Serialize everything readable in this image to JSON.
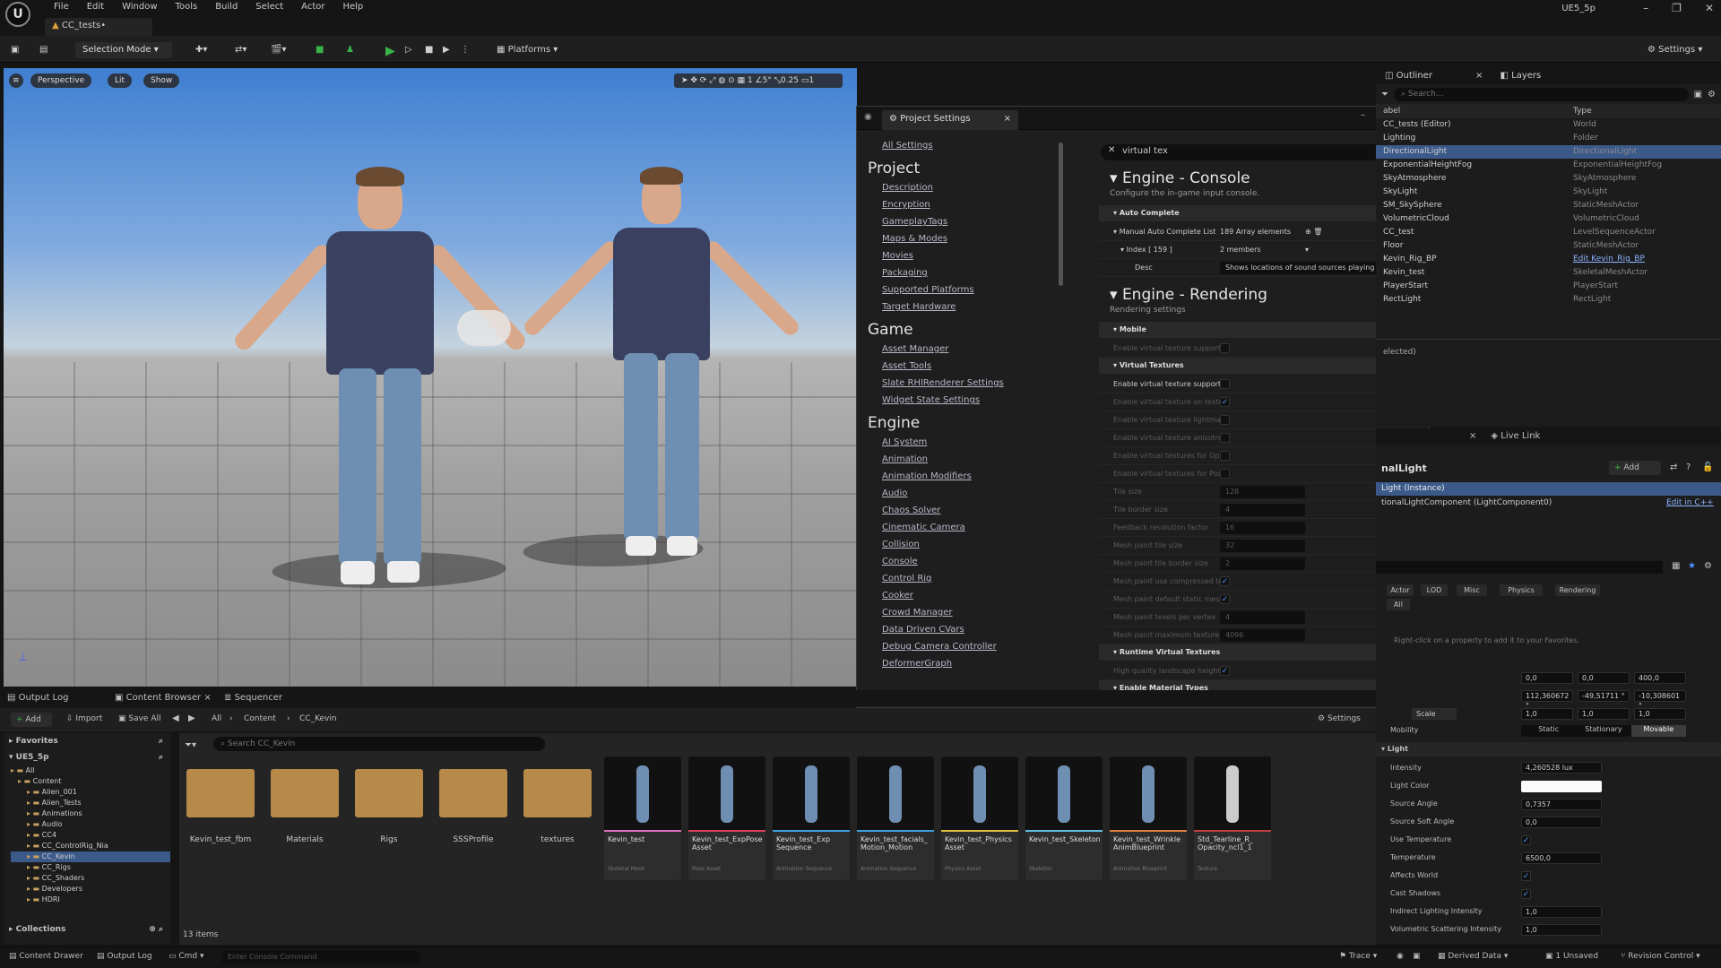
{
  "menu": [
    "File",
    "Edit",
    "Window",
    "Tools",
    "Build",
    "Select",
    "Actor",
    "Help"
  ],
  "doc_tab": "CC_tests•",
  "project_name": "UE5_5p",
  "toolbar": {
    "selection_mode": "Selection Mode",
    "platforms": "Platforms",
    "settings": "Settings"
  },
  "viewport": {
    "perspective": "Perspective",
    "lit": "Lit",
    "show": "Show",
    "snap_deg": "5°",
    "grid": "1",
    "scale": "0.25",
    "cam": "1"
  },
  "project_settings": {
    "title": "Project Settings",
    "all_settings": "All Settings",
    "search": "virtual tex",
    "nav": [
      {
        "head": "Project",
        "links": [
          "Description",
          "Encryption",
          "GameplayTags",
          "Maps & Modes",
          "Movies",
          "Packaging",
          "Supported Platforms",
          "Target Hardware"
        ]
      },
      {
        "head": "Game",
        "links": [
          "Asset Manager",
          "Asset Tools",
          "Slate RHIRenderer Settings",
          "Widget State Settings"
        ]
      },
      {
        "head": "Engine",
        "links": [
          "AI System",
          "Animation",
          "Animation Modifiers",
          "Audio",
          "Chaos Solver",
          "Cinematic Camera",
          "Collision",
          "Console",
          "Control Rig",
          "Cooker",
          "Crowd Manager",
          "Data Driven CVars",
          "Debug Camera Controller",
          "DeformerGraph"
        ]
      }
    ],
    "console": {
      "title": "Engine - Console",
      "desc": "Configure the in-game input console.",
      "category": "Auto Complete",
      "list_label": "Manual Auto Complete List",
      "list_value": "189 Array elements",
      "index_label": "Index [ 159 ]",
      "index_value": "2 members",
      "desc_label": "Desc",
      "desc_value": "Shows locations of sound sources playing (s"
    },
    "rendering": {
      "title": "Engine - Rendering",
      "desc": "Rendering settings",
      "mobile": "Mobile",
      "mobile_prop": "Enable virtual texture support",
      "vt": "Virtual Textures",
      "props": [
        {
          "n": "Enable virtual texture support",
          "v": "",
          "dim": false
        },
        {
          "n": "Enable virtual texture on textur...",
          "v": "✓",
          "dim": true
        },
        {
          "n": "Enable virtual texture lightmaps",
          "v": "",
          "dim": true
        },
        {
          "n": "Enable virtual texture anisotro...",
          "v": "",
          "dim": true
        },
        {
          "n": "Enable virtual textures for Opa...",
          "v": "",
          "dim": true
        },
        {
          "n": "Enable virtual textures for Pos...",
          "v": "",
          "dim": true
        },
        {
          "n": "Tile size",
          "v": "128",
          "dim": true
        },
        {
          "n": "Tile border size",
          "v": "4",
          "dim": true
        },
        {
          "n": "Feedback resolution factor",
          "v": "16",
          "dim": true
        },
        {
          "n": "Mesh paint tile size",
          "v": "32",
          "dim": true
        },
        {
          "n": "Mesh paint tile border size",
          "v": "2",
          "dim": true
        },
        {
          "n": "Mesh paint use compressed te...",
          "v": "✓",
          "dim": true
        },
        {
          "n": "Mesh paint default static mes...",
          "v": "✓",
          "dim": true
        },
        {
          "n": "Mesh paint texels per vertex",
          "v": "4",
          "dim": true
        },
        {
          "n": "Mesh paint maximum texture...",
          "v": "4096",
          "dim": true
        }
      ],
      "rvt": "Runtime Virtual Textures",
      "rvt_prop": "High quality landscape height...",
      "emt": "Enable Material Types"
    }
  },
  "outliner": {
    "tab": "Outliner",
    "layers_tab": "Layers",
    "search": "Search...",
    "col_label": "abel",
    "col_type": "Type",
    "rows": [
      {
        "n": "CC_tests (Editor)",
        "t": "World"
      },
      {
        "n": "Lighting",
        "t": "Folder"
      },
      {
        "n": "DirectionalLight",
        "t": "DirectionalLight",
        "sel": true
      },
      {
        "n": "ExponentialHeightFog",
        "t": "ExponentialHeightFog"
      },
      {
        "n": "SkyAtmosphere",
        "t": "SkyAtmosphere"
      },
      {
        "n": "SkyLight",
        "t": "SkyLight"
      },
      {
        "n": "SM_SkySphere",
        "t": "StaticMeshActor"
      },
      {
        "n": "VolumetricCloud",
        "t": "VolumetricCloud"
      },
      {
        "n": "CC_test",
        "t": "LevelSequenceActor"
      },
      {
        "n": "Floor",
        "t": "StaticMeshActor"
      },
      {
        "n": "Kevin_Rig_BP",
        "t": "Edit Kevin_Rig_BP"
      },
      {
        "n": "Kevin_test",
        "t": "SkeletalMeshActor"
      },
      {
        "n": "PlayerStart",
        "t": "PlayerStart"
      },
      {
        "n": "RectLight",
        "t": "RectLight"
      }
    ],
    "selected_status": "elected)"
  },
  "details": {
    "live_link": "Live Link",
    "title": "nalLight",
    "add": "Add",
    "instance": "Light (Instance)",
    "component": "tionalLightComponent (LightComponent0)",
    "edit_cpp": "Edit in C++",
    "filters": [
      "Actor",
      "LOD",
      "Misc",
      "Physics",
      "Rendering",
      "All"
    ],
    "favorites_hint": "Right-click on a property to add it to your Favorites.",
    "loc": [
      "0,0",
      "0,0",
      "400,0"
    ],
    "rot": [
      "112,360672 °",
      "-49,51711 °",
      "-10,308601 °"
    ],
    "scale_label": "Scale",
    "scale": [
      "1,0",
      "1,0",
      "1,0"
    ],
    "mobility": "Mobility",
    "mobility_opts": [
      "Static",
      "Stationary",
      "Movable"
    ],
    "light_cat": "Light",
    "intensity_label": "Intensity",
    "intensity": "4,260528 lux",
    "color_label": "Light Color",
    "source_angle_label": "Source Angle",
    "source_angle": "0,7357",
    "source_soft_label": "Source Soft Angle",
    "source_soft": "0,0",
    "use_temp_label": "Use Temperature",
    "temp_label": "Temperature",
    "temp": "6500,0",
    "affects_world_label": "Affects World",
    "cast_shadows_label": "Cast Shadows",
    "indirect_label": "Indirect Lighting Intensity",
    "indirect": "1,0",
    "volumetric_label": "Volumetric Scattering Intensity",
    "volumetric": "1,0"
  },
  "bottom": {
    "tabs": [
      "Output Log",
      "Content Browser",
      "Sequencer"
    ],
    "add": "Add",
    "import": "Import",
    "save_all": "Save All",
    "breadcrumb": [
      "All",
      "Content",
      "CC_Kevin"
    ],
    "settings": "Settings",
    "favorites": "Favorites",
    "project": "UE5_5p",
    "search": "Search CC_Kevin",
    "tree": [
      "All",
      "Content",
      "Alien_001",
      "Alien_Tests",
      "Animations",
      "Audio",
      "CC4",
      "CC_ControlRig_Nia",
      "CC_Kevin",
      "CC_Rigs",
      "CC_Shaders",
      "Developers",
      "HDRI"
    ],
    "collections": "Collections",
    "count": "13 items",
    "folders": [
      "Kevin_test_fbm",
      "Materials",
      "Rigs",
      "SSSProfile",
      "textures"
    ],
    "assets": [
      {
        "n": "Kevin_test",
        "t": "Skeletal Mesh",
        "c": "#e070c0"
      },
      {
        "n": "Kevin_test_ExpPose Asset",
        "t": "Pose Asset",
        "c": "#e04060"
      },
      {
        "n": "Kevin_test_Exp Sequence",
        "t": "Animation Sequence",
        "c": "#40a0e0"
      },
      {
        "n": "Kevin_test_facials_ Motion_Motion",
        "t": "Animation Sequence",
        "c": "#40a0e0"
      },
      {
        "n": "Kevin_test_Physics Asset",
        "t": "Physics Asset",
        "c": "#e0c040"
      },
      {
        "n": "Kevin_test_Skeleton",
        "t": "Skeleton",
        "c": "#60c0e0"
      },
      {
        "n": "Kevin_test_Wrinkle AnimBlueprint",
        "t": "Animation Blueprint",
        "c": "#e08040"
      },
      {
        "n": "Std_Tearline_R_ Opacity_ncl1_1",
        "t": "Texture",
        "c": "#c04040"
      }
    ]
  },
  "status": {
    "content_drawer": "Content Drawer",
    "output_log": "Output Log",
    "cmd": "Cmd",
    "console_placeholder": "Enter Console Command",
    "trace": "Trace",
    "derived": "Derived Data",
    "unsaved": "1 Unsaved",
    "revision": "Revision Control"
  }
}
